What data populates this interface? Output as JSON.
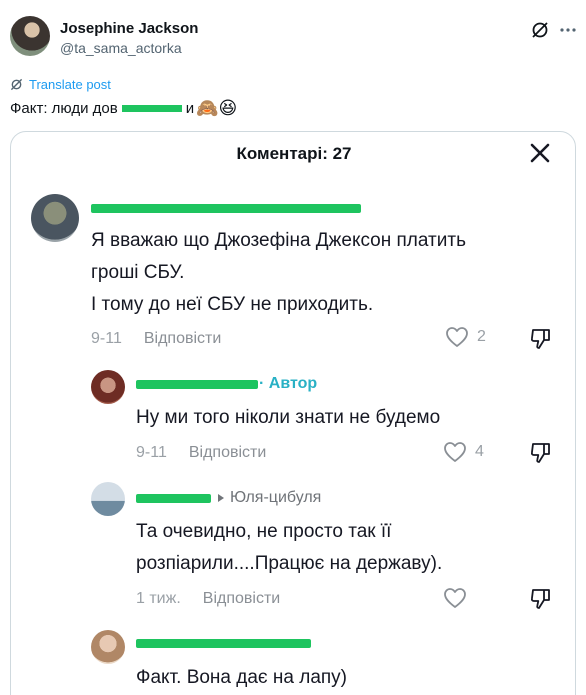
{
  "post": {
    "author_name": "Josephine Jackson",
    "author_handle": "@ta_sama_actorka",
    "translate_label": "Translate post",
    "text_before": "Факт: люди дов",
    "text_after": "и",
    "emojis": "🙈😆"
  },
  "modal": {
    "title": "Коментарі: 27"
  },
  "comments": [
    {
      "text_line1": "Я вважаю що Джозефіна Джексон платить",
      "text_line2": "гроші СБУ.",
      "text_line3": "І тому до неї СБУ не приходить.",
      "date": "9-11",
      "reply_label": "Відповісти",
      "likes": "2"
    },
    {
      "author_tag": "· Автор",
      "text_line1": "Ну ми того ніколи знати не будемо",
      "date": "9-11",
      "reply_label": "Відповісти",
      "likes": "4"
    },
    {
      "reply_to": "Юля-цибуля",
      "text_line1": "Та очевидно, не просто так її",
      "text_line2": "розпіарили....Працює на державу).",
      "date": "1 тиж.",
      "reply_label": "Відповісти"
    },
    {
      "text_line1": "Факт. Вона дає на лапу)"
    }
  ]
}
